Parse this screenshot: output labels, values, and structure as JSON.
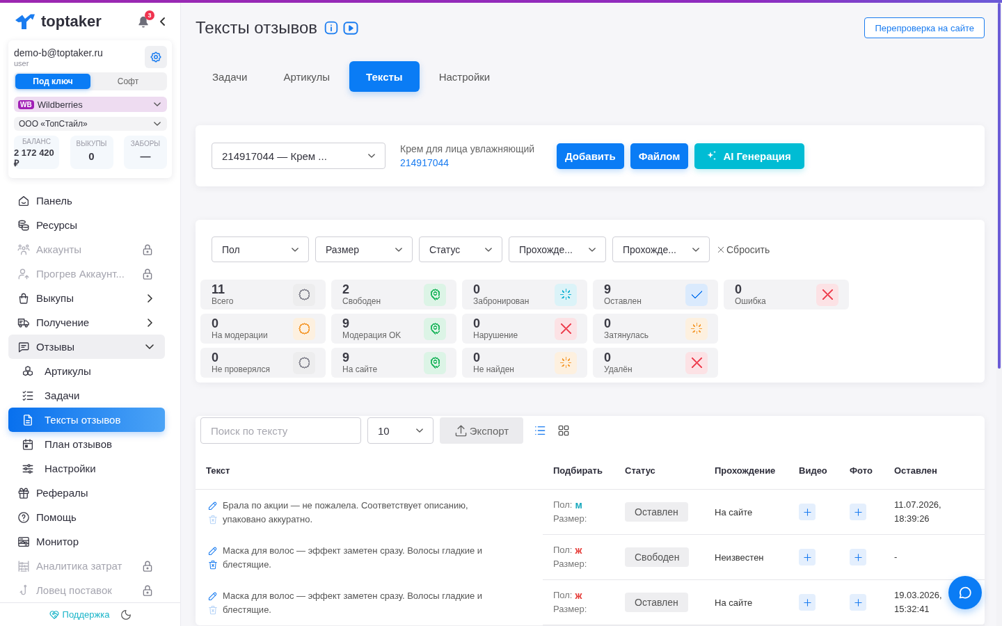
{
  "sidebar": {
    "logo": "toptaker",
    "notifications": "3",
    "account": {
      "email": "demo-b@toptaker.ru",
      "role": "user"
    },
    "modes": [
      {
        "label": "Под ключ",
        "selected": true
      },
      {
        "label": "Софт",
        "selected": false
      }
    ],
    "marketplace": {
      "badge": "WB",
      "name": "Wildberries"
    },
    "company": "ООО «ТопСтайл»",
    "balances": [
      {
        "label": "БАЛАНС",
        "value": "2 172 420 ₽"
      },
      {
        "label": "ВЫКУПЫ",
        "value": "0"
      },
      {
        "label": "ЗАБОРЫ",
        "value": "—"
      }
    ],
    "nav": [
      {
        "label": "Панель",
        "kind": "link",
        "selected": false,
        "disabled": false
      },
      {
        "label": "Ресурсы",
        "kind": "link",
        "selected": false,
        "disabled": false
      },
      {
        "label": "Аккаунты",
        "kind": "link",
        "selected": false,
        "disabled": true
      },
      {
        "label": "Прогрев Аккаунт...",
        "kind": "link",
        "selected": false,
        "disabled": true
      },
      {
        "label": "Выкупы",
        "kind": "group",
        "expanded": false,
        "selected": false,
        "disabled": false
      },
      {
        "label": "Получение",
        "kind": "group",
        "expanded": false,
        "selected": false,
        "disabled": false
      },
      {
        "label": "Отзывы",
        "kind": "group",
        "expanded": true,
        "selected": false,
        "disabled": false,
        "children": [
          {
            "label": "Артикулы",
            "selected": false
          },
          {
            "label": "Задачи",
            "selected": false
          },
          {
            "label": "Тексты отзывов",
            "selected": true
          },
          {
            "label": "План отзывов",
            "selected": false
          },
          {
            "label": "Настройки",
            "selected": false
          }
        ]
      },
      {
        "label": "Рефералы",
        "kind": "link",
        "selected": false,
        "disabled": false
      },
      {
        "label": "Помощь",
        "kind": "link",
        "selected": false,
        "disabled": false
      },
      {
        "label": "Монитор",
        "kind": "link",
        "selected": false,
        "disabled": false
      },
      {
        "label": "Аналитика затрат",
        "kind": "link",
        "selected": false,
        "disabled": true
      },
      {
        "label": "Ловец поставок",
        "kind": "link",
        "selected": false,
        "disabled": true
      }
    ],
    "support": "Поддержка"
  },
  "page": {
    "title": "Тексты отзывов",
    "recheck": "Перепроверка на сайте"
  },
  "tabs": [
    {
      "label": "Задачи",
      "selected": false
    },
    {
      "label": "Артикулы",
      "selected": false
    },
    {
      "label": "Тексты",
      "selected": true
    },
    {
      "label": "Настройки",
      "selected": false
    }
  ],
  "product": {
    "article": "214917044 — Крем ...",
    "name": "Крем для лица увлажняющий",
    "link": "214917044",
    "actions": [
      {
        "label": "Добавить",
        "kind": "primary"
      },
      {
        "label": "Файлом",
        "kind": "primary"
      },
      {
        "label": "AI Генерация",
        "kind": "ai"
      }
    ]
  },
  "filters": {
    "selects": [
      "Пол",
      "Размер",
      "Статус",
      "Прохожде...",
      "Прохожде..."
    ],
    "reset": "Сбросить"
  },
  "stats": [
    [
      {
        "count": "11",
        "label": "Всего",
        "kind": "idle",
        "color": "#8c8c96"
      },
      {
        "count": "2",
        "label": "Свободен",
        "kind": "ok",
        "color": "#27b864"
      },
      {
        "count": "0",
        "label": "Забронирован",
        "kind": "progress",
        "color": "#1fb6d5"
      },
      {
        "count": "9",
        "label": "Оставлен",
        "kind": "done",
        "color": "#1a7cf0"
      },
      {
        "count": "0",
        "label": "Ошибка",
        "kind": "fail",
        "color": "#ee4b5a"
      }
    ],
    [
      {
        "count": "0",
        "label": "На модерации",
        "kind": "idle",
        "color": "#f59f3a"
      },
      {
        "count": "9",
        "label": "Модерация OK",
        "kind": "ok",
        "color": "#27b864"
      },
      {
        "count": "0",
        "label": "Нарушение",
        "kind": "fail",
        "color": "#ee4b5a"
      },
      {
        "count": "0",
        "label": "Затянулась",
        "kind": "progress",
        "color": "#f59f3a"
      }
    ],
    [
      {
        "count": "0",
        "label": "Не проверялся",
        "kind": "idle",
        "color": "#8c8c96"
      },
      {
        "count": "9",
        "label": "На сайте",
        "kind": "ok",
        "color": "#27b864"
      },
      {
        "count": "0",
        "label": "Не найден",
        "kind": "progress",
        "color": "#f59f3a"
      },
      {
        "count": "0",
        "label": "Удалён",
        "kind": "fail",
        "color": "#ee4b5a"
      }
    ]
  ],
  "reviews": {
    "search_placeholder": "Поиск по тексту",
    "page_size": "10",
    "export": "Экспорт",
    "views": [
      {
        "selected": true
      },
      {
        "selected": false
      }
    ],
    "columns": [
      "Текст",
      "Подбирать",
      "Статус",
      "Прохождение",
      "Видео",
      "Фото",
      "Оставлен"
    ],
    "rows": [
      {
        "text": "Брала по акции — не пожалела. Соответствует описанию, упаковано аккуратно.",
        "delete_disabled": true,
        "sex_label": "Пол:",
        "sex": "м",
        "color": "#17a8bd",
        "size_label": "Размер:",
        "status": "Оставлен",
        "passage": "На сайте",
        "posted": "11.07.2026, 18:39:26"
      },
      {
        "text": "Маска для волос — эффект заметен сразу. Волосы гладкие и блестящие.",
        "delete_disabled": false,
        "sex_label": "Пол:",
        "sex": "ж",
        "color": "#e53935",
        "size_label": "Размер:",
        "status": "Свободен",
        "passage": "Неизвестен",
        "posted": "-"
      },
      {
        "text": "Маска для волос — эффект заметен сразу. Волосы гладкие и блестящие.",
        "delete_disabled": true,
        "sex_label": "Пол:",
        "sex": "ж",
        "color": "#e53935",
        "size_label": "Размер:",
        "status": "Оставлен",
        "passage": "На сайте",
        "posted": "19.03.2026, 15:32:41"
      }
    ]
  }
}
